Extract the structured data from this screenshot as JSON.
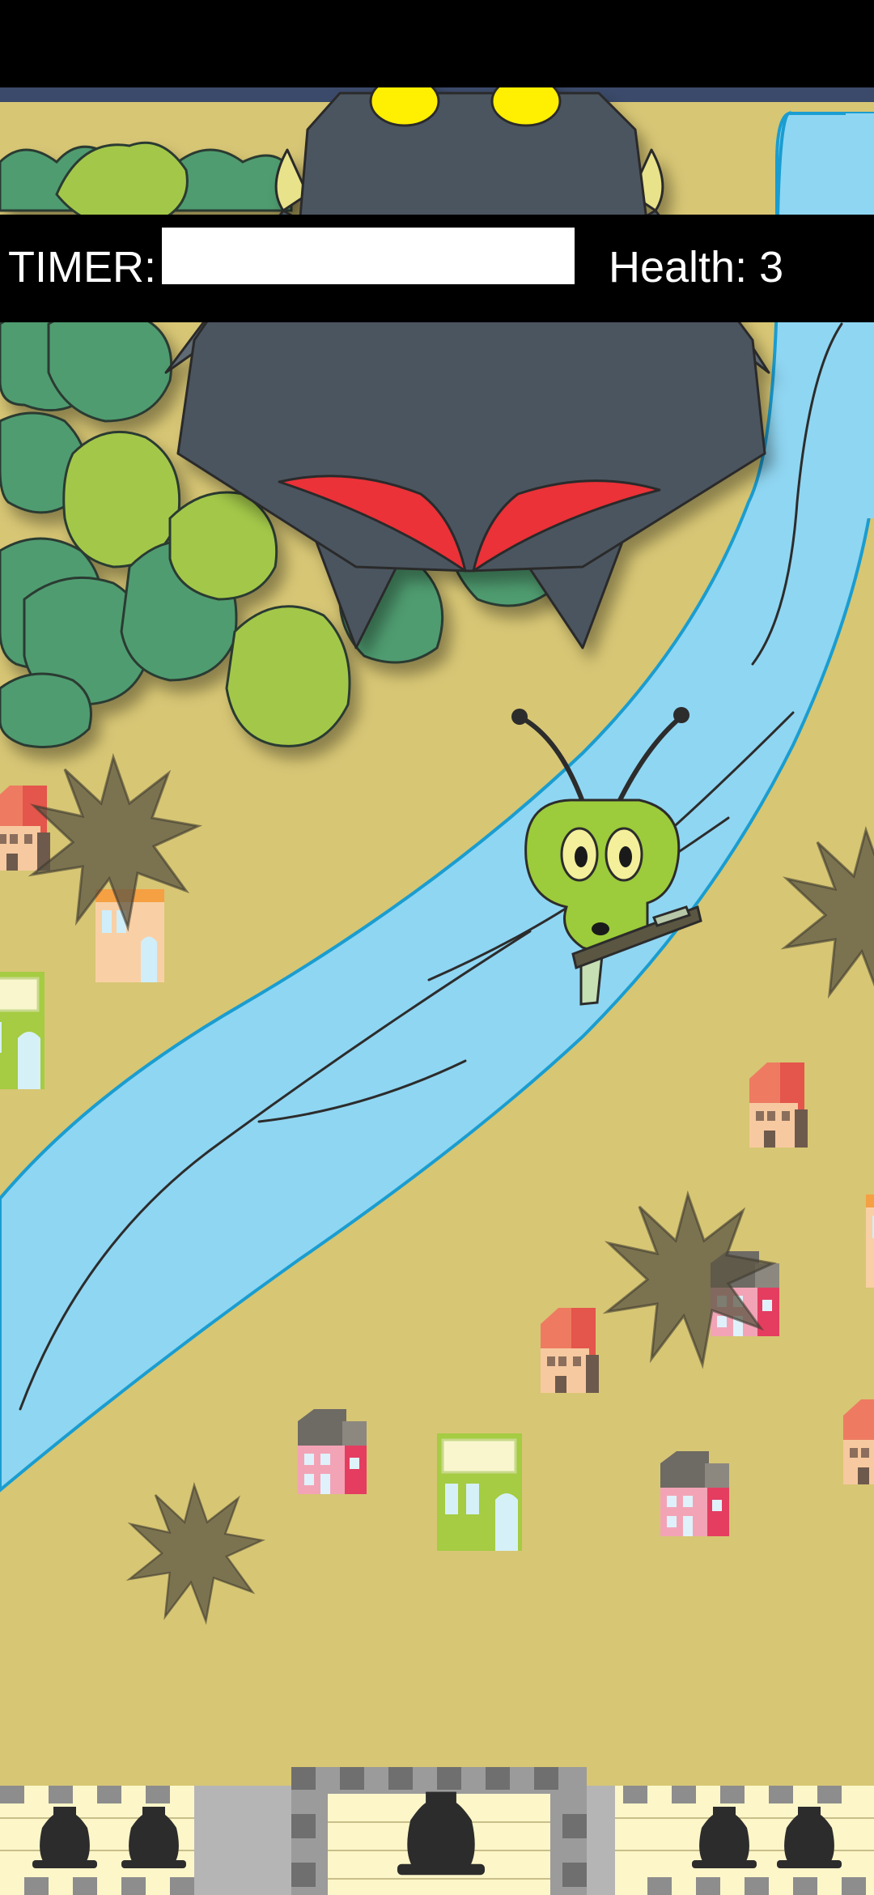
{
  "hud": {
    "timer_label": "TIMER:",
    "timer_progress": 1.0,
    "health_text": "Health: 3",
    "health_value": 3
  },
  "colors": {
    "ground": "#d7c674",
    "river": "#8fd6f2",
    "river_edge": "#1a9dd0",
    "boss": "#4b5560",
    "boss_wing": "#5e6a75",
    "boss_eye": "#ffef00",
    "boss_mouth": "#ea3038",
    "alien_skin": "#9ccb3b",
    "tree_dark": "#4f9c70",
    "tree_light": "#a3c84a",
    "wall_cream": "#fdf6c9",
    "wall_grey": "#8d8d8d",
    "blast": "#5c5643"
  },
  "sprites": {
    "boss": "boss-ship-icon",
    "player": "alien-player-icon",
    "weapon": "blaster-icon",
    "crater": "explosion-crater-icon",
    "house": "house-icon",
    "cannon": "cannon-icon"
  }
}
